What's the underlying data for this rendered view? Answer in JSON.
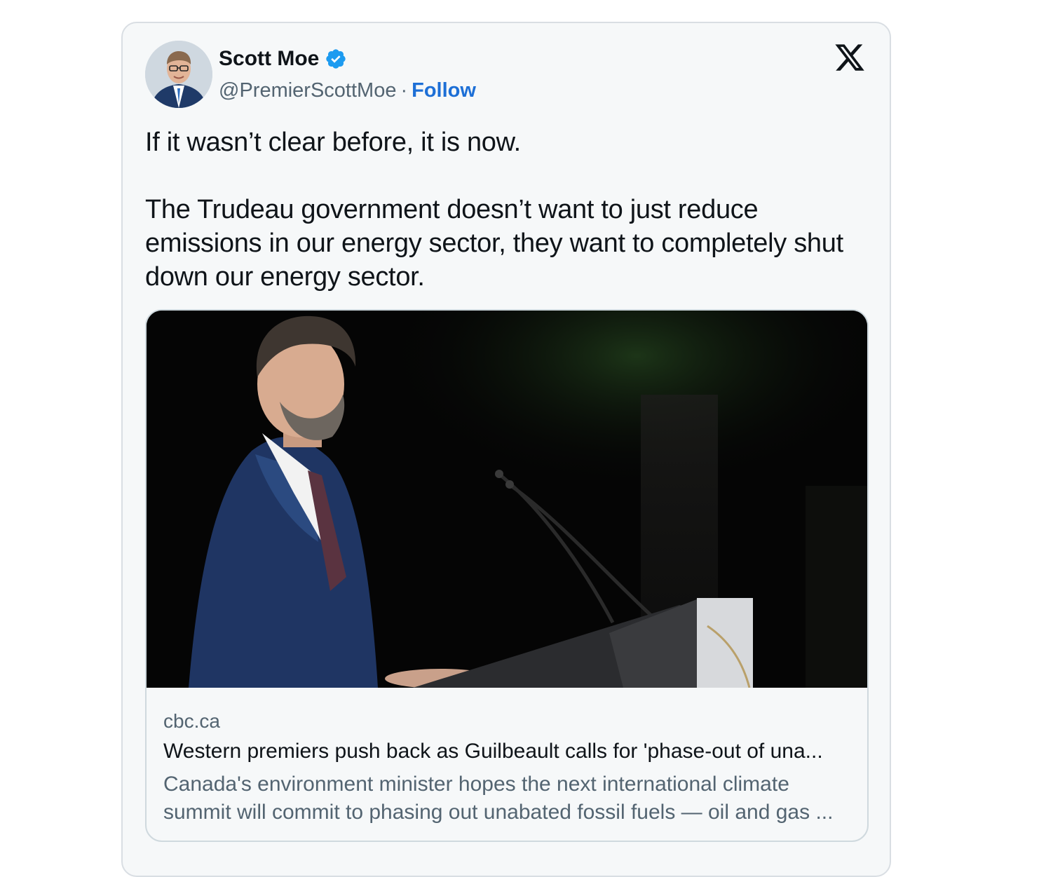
{
  "tweet": {
    "author": {
      "display_name": "Scott Moe",
      "handle": "@PremierScottMoe",
      "verified": true,
      "avatar_icon": "profile-photo"
    },
    "separator": "·",
    "follow_label": "Follow",
    "platform_icon": "x-logo-icon",
    "text": "If it wasn’t clear before, it is now.\n\nThe Trudeau government doesn’t want to just reduce emissions in our energy sector, they want to completely shut down our energy sector.",
    "link_card": {
      "image_icon": "photo-man-at-podium",
      "domain": "cbc.ca",
      "title": "Western premiers push back as Guilbeault calls for 'phase-out of una...",
      "description": "Canada's environment minister hopes the next international climate summit will commit to phasing out unabated fossil fuels — oil and gas ..."
    }
  },
  "colors": {
    "background": "#ffffff",
    "card_background": "#f6f8f9",
    "card_border": "#d9dee3",
    "text_primary": "#0f1419",
    "text_secondary": "#536471",
    "follow_blue": "#1d6fd6",
    "verified_blue": "#1d9bf0"
  }
}
